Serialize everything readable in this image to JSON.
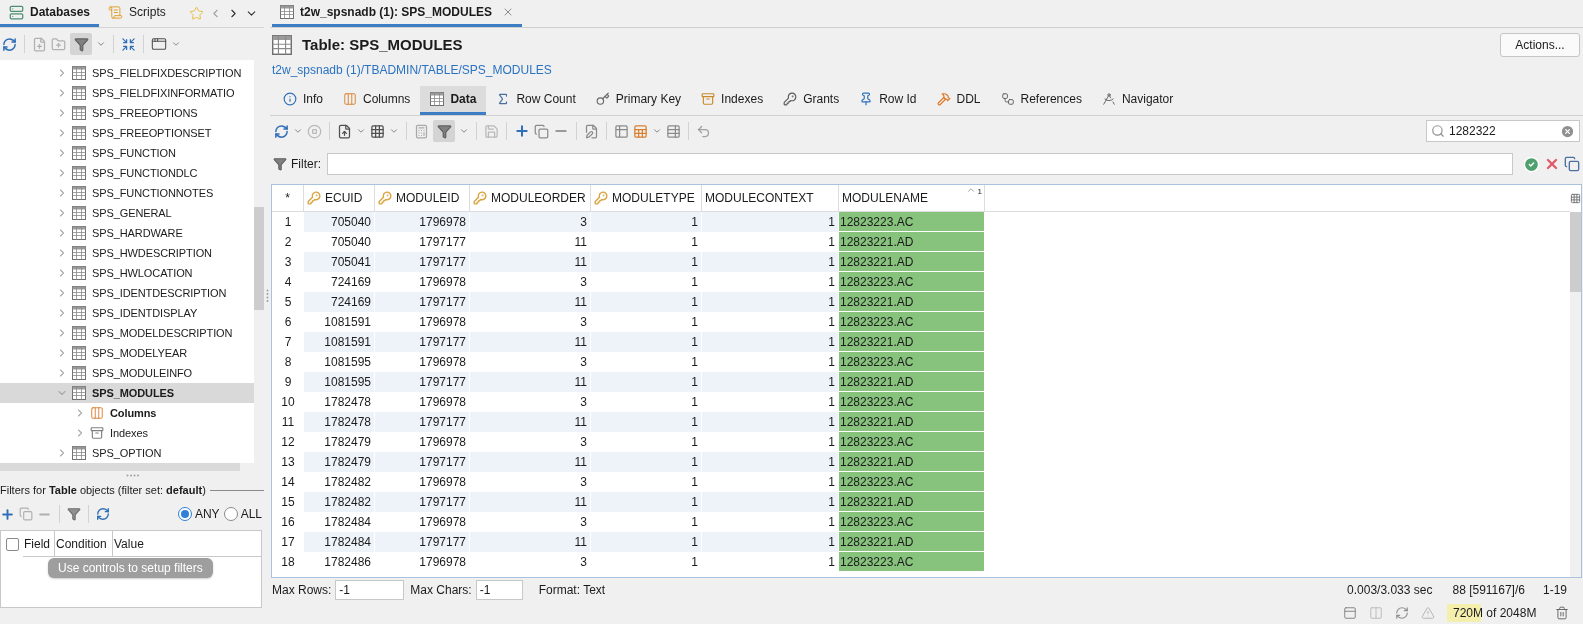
{
  "sidebar": {
    "tabs": [
      {
        "label": "Databases",
        "selected": true
      },
      {
        "label": "Scripts",
        "selected": false
      }
    ],
    "tree": [
      {
        "label": "SPS_FIELDFIXDESCRIPTION",
        "kind": "table",
        "expanded": false,
        "selected": false,
        "emphasized": false
      },
      {
        "label": "SPS_FIELDFIXINFORMATIO",
        "kind": "table",
        "expanded": false,
        "selected": false,
        "emphasized": false
      },
      {
        "label": "SPS_FREEOPTIONS",
        "kind": "table",
        "expanded": false,
        "selected": false,
        "emphasized": false
      },
      {
        "label": "SPS_FREEOPTIONSET",
        "kind": "table",
        "expanded": false,
        "selected": false,
        "emphasized": false
      },
      {
        "label": "SPS_FUNCTION",
        "kind": "table",
        "expanded": false,
        "selected": false,
        "emphasized": false
      },
      {
        "label": "SPS_FUNCTIONDLC",
        "kind": "table",
        "expanded": false,
        "selected": false,
        "emphasized": false
      },
      {
        "label": "SPS_FUNCTIONNOTES",
        "kind": "table",
        "expanded": false,
        "selected": false,
        "emphasized": false
      },
      {
        "label": "SPS_GENERAL",
        "kind": "table",
        "expanded": false,
        "selected": false,
        "emphasized": false
      },
      {
        "label": "SPS_HARDWARE",
        "kind": "table",
        "expanded": false,
        "selected": false,
        "emphasized": false
      },
      {
        "label": "SPS_HWDESCRIPTION",
        "kind": "table",
        "expanded": false,
        "selected": false,
        "emphasized": false
      },
      {
        "label": "SPS_HWLOCATION",
        "kind": "table",
        "expanded": false,
        "selected": false,
        "emphasized": false
      },
      {
        "label": "SPS_IDENTDESCRIPTION",
        "kind": "table",
        "expanded": false,
        "selected": false,
        "emphasized": false
      },
      {
        "label": "SPS_IDENTDISPLAY",
        "kind": "table",
        "expanded": false,
        "selected": false,
        "emphasized": false
      },
      {
        "label": "SPS_MODELDESCRIPTION",
        "kind": "table",
        "expanded": false,
        "selected": false,
        "emphasized": false
      },
      {
        "label": "SPS_MODELYEAR",
        "kind": "table",
        "expanded": false,
        "selected": false,
        "emphasized": false
      },
      {
        "label": "SPS_MODULEINFO",
        "kind": "table",
        "expanded": false,
        "selected": false,
        "emphasized": false
      },
      {
        "label": "SPS_MODULES",
        "kind": "table",
        "expanded": true,
        "selected": true,
        "emphasized": true,
        "children": [
          {
            "label": "Columns",
            "kind": "columns",
            "expanded": false,
            "selected": false,
            "emphasized": true
          },
          {
            "label": "Indexes",
            "kind": "indexes",
            "expanded": false,
            "selected": false,
            "emphasized": false
          }
        ]
      },
      {
        "label": "SPS_OPTION",
        "kind": "table",
        "expanded": false,
        "selected": false,
        "emphasized": false
      }
    ]
  },
  "filters": {
    "title": "Filters for **Table** objects (filter set: **default**)",
    "match": [
      {
        "label": "ANY",
        "selected": true
      },
      {
        "label": "ALL",
        "selected": false
      }
    ],
    "select_all": {
      "checked": false
    },
    "columns": [
      "Field",
      "Condition",
      "Value"
    ],
    "hint": "Use controls to setup filters"
  },
  "editor": {
    "tab": {
      "label": "t2w_spsnadb (1): SPS_MODULES",
      "selected": true
    },
    "title": "Table: SPS_MODULES",
    "path": "t2w_spsnadb (1)/TBADMIN/TABLE/SPS_MODULES",
    "actions": "Actions...",
    "tabs": [
      {
        "label": "Info",
        "selected": false
      },
      {
        "label": "Columns",
        "selected": false
      },
      {
        "label": "Data",
        "selected": true
      },
      {
        "label": "Row Count",
        "selected": false
      },
      {
        "label": "Primary Key",
        "selected": false
      },
      {
        "label": "Indexes",
        "selected": false
      },
      {
        "label": "Grants",
        "selected": false
      },
      {
        "label": "Row Id",
        "selected": false
      },
      {
        "label": "DDL",
        "selected": false
      },
      {
        "label": "References",
        "selected": false
      },
      {
        "label": "Navigator",
        "selected": false
      }
    ],
    "search": {
      "value": "1282322"
    },
    "filter": {
      "label": "Filter:"
    },
    "table": {
      "row_header": "*",
      "columns": [
        {
          "label": "ECUID",
          "key": true,
          "kind": "number",
          "highlighted": false
        },
        {
          "label": "MODULEID",
          "key": true,
          "kind": "number",
          "highlighted": false
        },
        {
          "label": "MODULEORDER",
          "key": true,
          "kind": "number",
          "highlighted": false
        },
        {
          "label": "MODULETYPE",
          "key": true,
          "kind": "number",
          "highlighted": false
        },
        {
          "label": "MODULECONTEXT",
          "key": false,
          "kind": "number",
          "highlighted": false
        },
        {
          "label": "MODULENAME",
          "key": false,
          "kind": "text",
          "highlighted": true,
          "sort_order": "1"
        }
      ],
      "rows": [
        {
          "number": "1",
          "cells": [
            "705040",
            "1796978",
            "3",
            "1",
            "1",
            "12823223.AC"
          ]
        },
        {
          "number": "2",
          "cells": [
            "705040",
            "1797177",
            "11",
            "1",
            "1",
            "12823221.AD"
          ]
        },
        {
          "number": "3",
          "cells": [
            "705041",
            "1797177",
            "11",
            "1",
            "1",
            "12823221.AD"
          ]
        },
        {
          "number": "4",
          "cells": [
            "724169",
            "1796978",
            "3",
            "1",
            "1",
            "12823223.AC"
          ]
        },
        {
          "number": "5",
          "cells": [
            "724169",
            "1797177",
            "11",
            "1",
            "1",
            "12823221.AD"
          ]
        },
        {
          "number": "6",
          "cells": [
            "1081591",
            "1796978",
            "3",
            "1",
            "1",
            "12823223.AC"
          ]
        },
        {
          "number": "7",
          "cells": [
            "1081591",
            "1797177",
            "11",
            "1",
            "1",
            "12823221.AD"
          ]
        },
        {
          "number": "8",
          "cells": [
            "1081595",
            "1796978",
            "3",
            "1",
            "1",
            "12823223.AC"
          ]
        },
        {
          "number": "9",
          "cells": [
            "1081595",
            "1797177",
            "11",
            "1",
            "1",
            "12823221.AD"
          ]
        },
        {
          "number": "10",
          "cells": [
            "1782478",
            "1796978",
            "3",
            "1",
            "1",
            "12823223.AC"
          ]
        },
        {
          "number": "11",
          "cells": [
            "1782478",
            "1797177",
            "11",
            "1",
            "1",
            "12823221.AD"
          ]
        },
        {
          "number": "12",
          "cells": [
            "1782479",
            "1796978",
            "3",
            "1",
            "1",
            "12823223.AC"
          ]
        },
        {
          "number": "13",
          "cells": [
            "1782479",
            "1797177",
            "11",
            "1",
            "1",
            "12823221.AD"
          ]
        },
        {
          "number": "14",
          "cells": [
            "1782482",
            "1796978",
            "3",
            "1",
            "1",
            "12823223.AC"
          ]
        },
        {
          "number": "15",
          "cells": [
            "1782482",
            "1797177",
            "11",
            "1",
            "1",
            "12823221.AD"
          ]
        },
        {
          "number": "16",
          "cells": [
            "1782484",
            "1796978",
            "3",
            "1",
            "1",
            "12823223.AC"
          ]
        },
        {
          "number": "17",
          "cells": [
            "1782484",
            "1797177",
            "11",
            "1",
            "1",
            "12823221.AD"
          ]
        },
        {
          "number": "18",
          "cells": [
            "1782486",
            "1796978",
            "3",
            "1",
            "1",
            "12823223.AC"
          ]
        }
      ]
    },
    "footer": {
      "max_rows": {
        "label": "Max Rows:",
        "value": "-1"
      },
      "max_chars": {
        "label": "Max Chars:",
        "value": "-1"
      },
      "format": "Format: Text",
      "time": "0.003/3.033 sec",
      "count": "88 [591167]/6",
      "range": "1-19"
    }
  },
  "status_bar": {
    "memory": {
      "text": "720M of 2048M",
      "level": 0.35
    }
  }
}
